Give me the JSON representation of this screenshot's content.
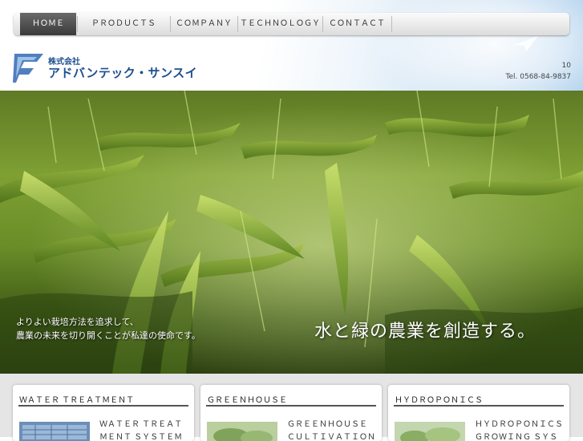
{
  "nav": {
    "items": [
      {
        "label": "ＨＯＭＥ"
      },
      {
        "label": "ＰＲＯＤＵＣＴＳ"
      },
      {
        "label": "ＣＯＭＰＡＮＹ"
      },
      {
        "label": "ＴＥＣＨＮＯＬＯＧＹ"
      },
      {
        "label": "ＣＯＮＴＡＣＴ"
      }
    ]
  },
  "header": {
    "company_prefix": "株式会社",
    "company_name": "アドバンテック・サンスイ",
    "number": "10",
    "tel": "Tel. 0568-84-9837"
  },
  "hero": {
    "title": "水と緑の農業を創造する。",
    "subtitle_lines": [
      "よりよい栽培方法を追求して、",
      "農業の未来を切り開くことが私達の使命です。"
    ]
  },
  "cards": [
    {
      "title": "ＷＡＴＥＲ ＴＲＥＡＴＭＥＮＴ",
      "text": "ＷＡＴＥＲ ＴＲＥＡＴＭＥＮＴ ＳＹＳＴＥＭＳ"
    },
    {
      "title": "ＧＲＥＥＮＨＯＵＳＥ",
      "text": "ＧＲＥＥＮＨＯＵＳＥ ＣＵＬＴＩＶＡＴＩＯＮ ＳＹＳ"
    },
    {
      "title": "ＨＹＤＲＯＰＯＮＩＣＳ",
      "text": "ＨＹＤＲＯＰＯＮＩＣＳ ＧＲＯＷＩＮＧ ＳＹＳＴＥＭ"
    }
  ],
  "colors": {
    "brand": "#1e4f8f",
    "nav_active": "#4a4a4a",
    "hero_text": "#ffffff"
  }
}
